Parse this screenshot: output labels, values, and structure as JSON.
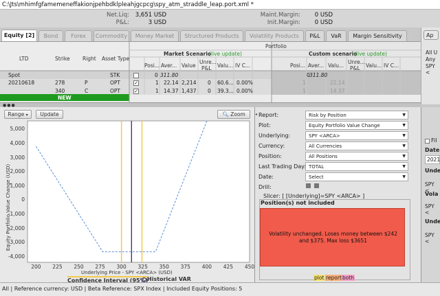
{
  "window": {
    "title": "C:\\Jts\\mhimfgfamemeneffakionjpehbdklpleahjgcpcg\\spy_atm_straddle_leap.port.xml *"
  },
  "account": {
    "net_liq_label": "Net.Liq:",
    "net_liq_value": "3,651 USD",
    "pnl_label": "P&L:",
    "pnl_value": "3 USD",
    "maint_label": "Maint.Margin:",
    "maint_value": "0 USD",
    "init_label": "Init.Margin:",
    "init_value": "0 USD"
  },
  "tabs": [
    {
      "label": "Equity [2]",
      "active": true
    },
    {
      "label": "Bond"
    },
    {
      "label": "Forex"
    },
    {
      "label": "Commodity"
    },
    {
      "label": "Money Market"
    },
    {
      "label": "Structured Products"
    },
    {
      "label": "Volatility Products"
    },
    {
      "label": "P&L"
    },
    {
      "label": "VaR"
    },
    {
      "label": "Margin Sensitivity"
    }
  ],
  "grid": {
    "portfolio_label": "Portfolio",
    "market_scenario": "Market Scenario",
    "custom_scenario": "Custom scenario",
    "live_update": "(live update)",
    "cols": {
      "ltd": "LTD",
      "strike": "Strike",
      "right": "Right",
      "asset_type": "Asset Type",
      "posi": "Posi...",
      "aver": "Aver...",
      "value": "Value",
      "unre1": "Unre...",
      "unre2": "P&L",
      "valu": "Valu...",
      "ivc": "IV C...",
      "aver2": "Aver...",
      "valu2": "Valu...",
      "unrep": "Unre...\nP&L",
      "ivc2": "IV C..."
    },
    "rows": [
      {
        "ltd": "Spot",
        "strike": "",
        "right": "",
        "asset": "STK",
        "posi": "0",
        "aver": "311.80",
        "value": "",
        "unre": "",
        "valu": "",
        "ivc": "",
        "cposi": "0",
        "caver": "311.80"
      },
      {
        "ltd": "20210618",
        "strike": "278",
        "right": "P",
        "asset": "OPT",
        "posi": "1",
        "aver": "22.14",
        "value": "2,214",
        "unre": "0",
        "valu": "60.6...",
        "ivc": "0.00%",
        "cposi": "1",
        "caver": "22.14"
      },
      {
        "ltd": "",
        "strike": "340",
        "right": "C",
        "asset": "OPT",
        "posi": "1",
        "aver": "14.37",
        "value": "1,437",
        "unre": "0",
        "valu": "39.3...",
        "ivc": "0.00%",
        "cposi": "1",
        "caver": "14.37"
      }
    ],
    "new_row": "NEW"
  },
  "right_panel_top": {
    "ap": "Ap",
    "all": "All U",
    "any": "Any",
    "spy": "SPY <"
  },
  "plot": {
    "range_btn": "Range",
    "update_btn": "Update",
    "zoom_btn": "Zoom",
    "ylabel": "Equity Portfolio Value Change (USD)",
    "xlabel": "Underlying Price - SPY <ARCA> (USD)",
    "legend_ci": "Confidence Interval (95%)",
    "legend_hv": "Historical VAR"
  },
  "chart_data": {
    "type": "line",
    "xlim": [
      190,
      450
    ],
    "ylim": [
      -4400,
      5600
    ],
    "xticks": [
      200,
      225,
      250,
      275,
      300,
      325,
      350,
      375,
      400,
      425,
      450
    ],
    "yticks": [
      5000,
      4000,
      3000,
      2000,
      1000,
      0,
      -1000,
      -2000,
      -3000,
      -4000
    ],
    "ytick_labels": [
      "5,000",
      "4,000",
      "3,000",
      "2,000",
      "1,000",
      "0",
      "-1,000",
      "-2,000",
      "-3,000",
      "-4,000"
    ],
    "series": [
      {
        "x": [
          200,
          278,
          300,
          325,
          340,
          400
        ],
        "y": [
          3800,
          -3651,
          -3651,
          -3651,
          -3651,
          5600
        ]
      }
    ],
    "vlines": [
      {
        "x": 300,
        "color": "#f2c94c"
      },
      {
        "x": 311.8,
        "color": "#3a2a6a"
      },
      {
        "x": 324,
        "color": "#f2c94c"
      }
    ],
    "colors": {
      "line": "#5b8fd6",
      "ci": "#f2c94c",
      "spot": "#3a2a6a"
    }
  },
  "form": {
    "report_label": "Report:",
    "report_value": "Risk by Position",
    "plot_label": "Plot:",
    "plot_value": "Equity Portfolio Value Change",
    "underlying_label": "Underlying:",
    "underlying_value": "SPY <ARCA>",
    "currency_label": "Currency:",
    "currency_value": "All Currencies",
    "position_label": "Position:",
    "position_value": "All Positions",
    "last_trading_label": "Last Trading Day:",
    "last_trading_value": "TOTAL",
    "date_label": "Date:",
    "date_value": "Select",
    "drill_label": "Drill:",
    "slicer": "Slicer: [ [Underlying]=SPY <ARCA> ]",
    "pos_not_included": "Position(s) not included",
    "note": "Volatility unchanged. Loses money between $242 and $375. Max loss $3651",
    "legend_plot": "plot",
    "legend_report": "report",
    "legend_both": "both"
  },
  "right_panel_bottom": {
    "fil": "Fil",
    "date": "Date",
    "d2021": "2021",
    "unde": "Unde",
    "spy": "SPY <",
    "vola": "Vola",
    "spy2": "SPY <",
    "unde2": "Unde",
    "spy3": "SPY <"
  },
  "status": {
    "text": "All | Reference currency: USD | Beta Reference: SPX Index | Included Equity Positions: 5"
  }
}
